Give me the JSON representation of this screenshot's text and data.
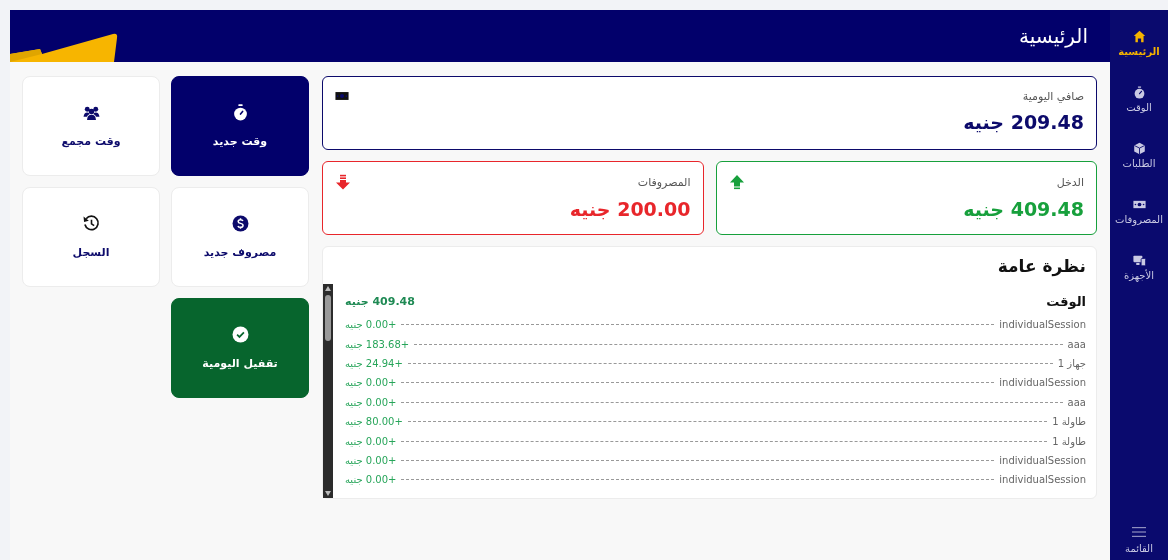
{
  "header": {
    "title": "الرئيسية"
  },
  "nav": {
    "items": [
      {
        "label": "الرئيسية",
        "selected": true
      },
      {
        "label": "الوقت",
        "selected": false
      },
      {
        "label": "الطلبات",
        "selected": false
      },
      {
        "label": "المصروفات",
        "selected": false
      },
      {
        "label": "الأجهزة",
        "selected": false
      }
    ],
    "menu": {
      "label": "القائمة"
    }
  },
  "summary": [
    {
      "label": "صافي اليومية",
      "value": "209.48 جنيه",
      "color": "#0c0a6b"
    },
    {
      "label": "الدخل",
      "value": "409.48 جنيه",
      "color": "#17a03c"
    },
    {
      "label": "المصروفات",
      "value": "200.00 جنيه",
      "color": "#e8262b"
    }
  ],
  "overview": {
    "title": "نظرة عامة",
    "section": {
      "title": "الوقت",
      "total": "409.48 جنيه",
      "rows": [
        {
          "name": "individualSession",
          "amount": "+0.00 جنيه"
        },
        {
          "name": "aaa",
          "amount": "+183.68 جنيه"
        },
        {
          "name": "جهاز 1",
          "amount": "+24.94 جنيه"
        },
        {
          "name": "individualSession",
          "amount": "+0.00 جنيه"
        },
        {
          "name": "aaa",
          "amount": "+0.00 جنيه"
        },
        {
          "name": "طاولة 1",
          "amount": "+80.00 جنيه"
        },
        {
          "name": "طاولة 1",
          "amount": "+0.00 جنيه"
        },
        {
          "name": "individualSession",
          "amount": "+0.00 جنيه"
        },
        {
          "name": "individualSession",
          "amount": "+0.00 جنيه"
        }
      ]
    }
  },
  "actions": [
    {
      "label": "وقت جديد",
      "kind": "primary"
    },
    {
      "label": "وقت مجمع",
      "kind": "plain"
    },
    {
      "label": "مصروف جديد",
      "kind": "plain"
    },
    {
      "label": "السجل",
      "kind": "plain"
    },
    {
      "label": "تقفيل اليومية",
      "kind": "success"
    }
  ]
}
